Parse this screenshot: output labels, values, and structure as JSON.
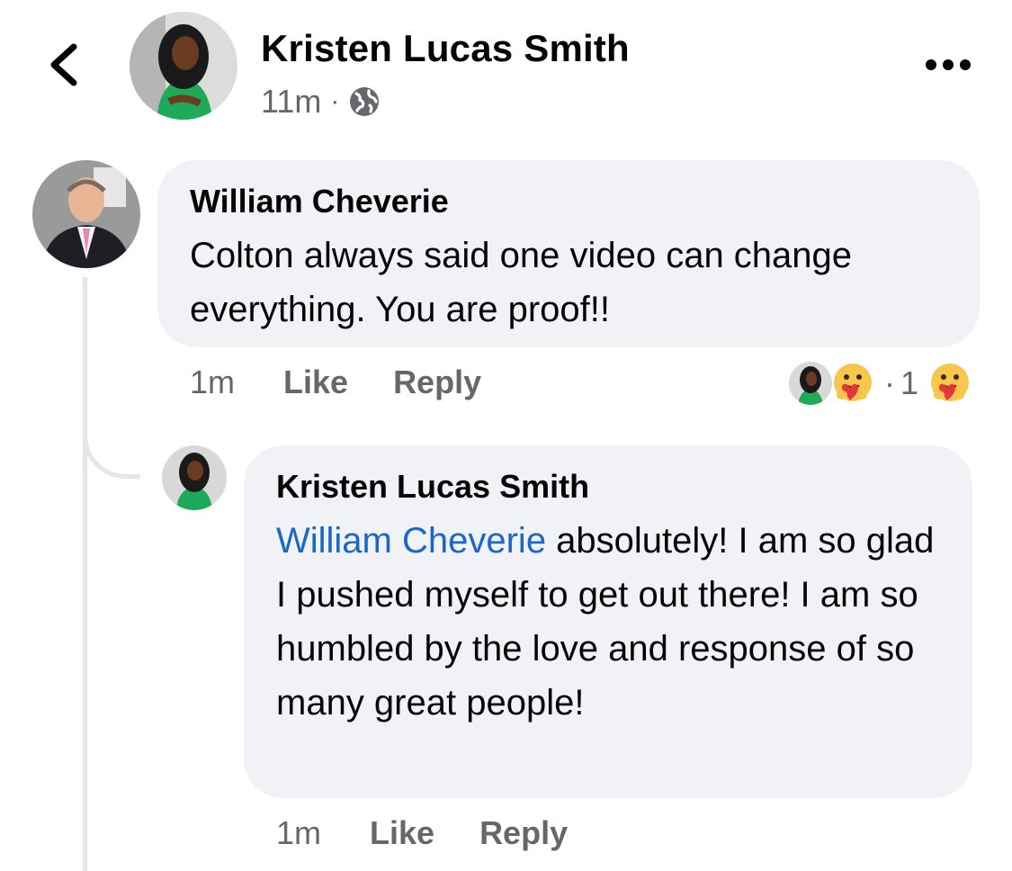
{
  "header": {
    "author": "Kristen Lucas Smith",
    "time": "11m",
    "separator": "·",
    "icons": {
      "back": "chevron-left-icon",
      "privacy": "globe-icon",
      "more": "more-horizontal-icon"
    }
  },
  "comments": [
    {
      "author": "William Cheverie",
      "text": "Colton always said one video can change everything. You are proof!!",
      "time": "1m",
      "like_label": "Like",
      "reply_label": "Reply",
      "reactions": {
        "separator": "·",
        "count": "1",
        "icons": [
          "reactor-avatar",
          "care-reaction-icon",
          "care-reaction-icon"
        ]
      }
    },
    {
      "author": "Kristen Lucas Smith",
      "mention": "William Cheverie",
      "text": " absolutely! I am so glad I pushed myself to get out there! I am so humbled by the love and response of so many great people!",
      "time": "1m",
      "like_label": "Like",
      "reply_label": "Reply"
    }
  ],
  "colors": {
    "bubble": "#f0f2f5",
    "secondary_text": "#65676b",
    "mention": "#1b66c9",
    "thread_line": "#e4e6eb"
  }
}
